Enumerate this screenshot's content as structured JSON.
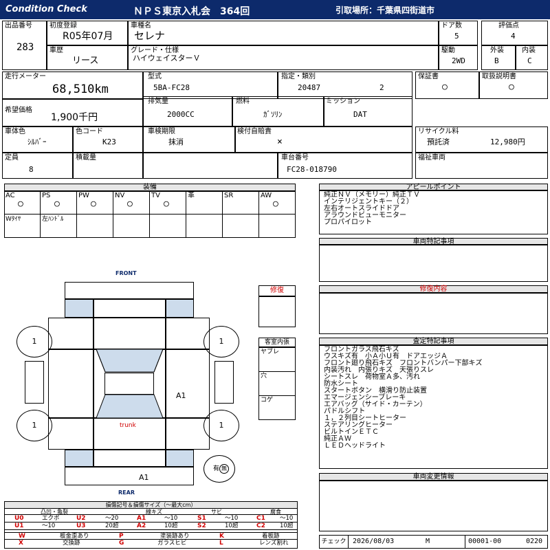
{
  "header": {
    "left": "Condition Check",
    "auction": "ＮＰＳ東京入札会　364回",
    "pickup": "引取場所：千葉県四街道市"
  },
  "row1": {
    "lot_label": "出品番号",
    "lot_value": "283",
    "first_reg_label": "初度登録",
    "first_reg_value": "R05年07月",
    "car_name_label": "車種名",
    "car_name_value": "セレナ",
    "doors_label": "ドア数",
    "doors_value": "5",
    "score_label": "評価点",
    "score_value": "4",
    "history_label": "車歴",
    "history_value": "リース",
    "grade_label": "グレード・仕様",
    "grade_value": "ハイウェイスターＶ",
    "drive_label": "駆動",
    "drive_value": "2WD",
    "ext_label": "外装",
    "ext_value": "B",
    "int_label": "内装",
    "int_value": "C"
  },
  "row2": {
    "odometer_label": "走行メーター",
    "odometer_value": "68,510km",
    "model_label": "型式",
    "model_value": "5BA-FC28",
    "designation_label": "指定・類別",
    "designation_value": "20487",
    "category_value": "2",
    "warranty_label": "保証書",
    "warranty_value": "○",
    "manual_label": "取扱説明書",
    "manual_value": "○",
    "price_label": "希望価格",
    "price_value": "1,900千円",
    "displacement_label": "排気量",
    "displacement_value": "2000CC",
    "fuel_label": "燃料",
    "fuel_value": "ｶﾞｿﾘﾝ",
    "mission_label": "ミッション",
    "mission_value": "DAT"
  },
  "row3": {
    "color_label": "車体色",
    "color_value": "ｼﾙﾊﾞｰ",
    "color_code_label": "色コード",
    "color_code_value": "K23",
    "inspection_label": "車検期限",
    "inspection_value": "抹消",
    "liability_label": "検付自賠責",
    "liability_value": "×",
    "recycle_label": "リサイクル料",
    "recycle_status": "預託済",
    "recycle_value": "12,980円",
    "capacity_label": "定員",
    "capacity_value": "8",
    "load_label": "積載量",
    "load_value": "",
    "chassis_label": "車台番号",
    "chassis_value": "FC28-018790",
    "welfare_label": "福祉車両",
    "welfare_value": ""
  },
  "equipment": {
    "title": "装備",
    "cols": [
      {
        "label": "AC",
        "value": "○"
      },
      {
        "label": "PS",
        "value": "○"
      },
      {
        "label": "PW",
        "value": "○"
      },
      {
        "label": "NV",
        "value": "○"
      },
      {
        "label": "TV",
        "value": "○"
      },
      {
        "label": "革",
        "value": ""
      },
      {
        "label": "SR",
        "value": ""
      },
      {
        "label": "AW",
        "value": "○"
      }
    ],
    "row2": [
      "Wﾀｲﾔ",
      "左ﾊﾝﾄﾞﾙ"
    ]
  },
  "diagram": {
    "front": "FRONT",
    "rear": "REAR",
    "trunk": "trunk",
    "tire_fl": "1",
    "tire_fr": "1",
    "tire_rl": "1",
    "tire_rr": "1",
    "mark_a1_side": "A1",
    "mark_a1_rear": "A1",
    "spare_label": "有",
    "spare_mark": "無"
  },
  "repair": {
    "title": "修復"
  },
  "cabin": {
    "title": "客室内張",
    "items": [
      "ヤブレ",
      "穴",
      "コゲ"
    ]
  },
  "appeal": {
    "title": "アピールポイント",
    "lines": [
      "純正ＮＶ（メモリー）純正ＴＶ",
      "インテリジェントキー（２）",
      "左右オートスライドドア",
      "アラウンドビューモニター",
      "プロパイロット"
    ]
  },
  "special": {
    "title": "車両特記事項"
  },
  "repair_content": {
    "title": "修復内容"
  },
  "inspection_notes": {
    "title": "査定特記事項",
    "lines": [
      "フロントガラス飛石キズ",
      "ウスキズ有　小Ａ小Ｕ有　ドアエッジＡ",
      "フロント廻り飛石キズ　フロントバンパー下部キズ",
      "内装汚れ　内張りキズ　天張りスレ",
      "シートスレ　荷物室Ａ多、汚れ",
      "防水シート",
      "スタートボタン　横滑り防止装置",
      "エマージェンシーブレーキ",
      "エアバッグ（サイド・カーテン）",
      "パドルシフト",
      "１，２列目シートヒーター",
      "ステアリングヒーター",
      "ビルトインＥＴＣ",
      "純正ＡＷ",
      "ＬＥＤヘッドライト"
    ]
  },
  "change_info": {
    "title": "車両変更情報"
  },
  "legend": {
    "title": "損傷記号＆損傷サイズ（～最大cm）",
    "groups": [
      "凸凹・亀裂",
      "線キズ",
      "サビ",
      "腐食"
    ],
    "rows": [
      [
        {
          "c": "U0",
          "t": "エクボ"
        },
        {
          "c": "U2",
          "t": "～20"
        },
        {
          "c": "A1",
          "t": "～10"
        },
        {
          "c": "S1",
          "t": "～10"
        },
        {
          "c": "C1",
          "t": "～10"
        }
      ],
      [
        {
          "c": "U1",
          "t": "～10"
        },
        {
          "c": "U3",
          "t": "20超"
        },
        {
          "c": "A2",
          "t": "10超"
        },
        {
          "c": "S2",
          "t": "10超"
        },
        {
          "c": "C2",
          "t": "10超"
        }
      ]
    ],
    "marks": [
      [
        {
          "c": "W",
          "t": "板金歪あり"
        },
        {
          "c": "P",
          "t": "塗装跡あり"
        },
        {
          "c": "K",
          "t": "着板跡"
        }
      ],
      [
        {
          "c": "X",
          "t": "交換跡"
        },
        {
          "c": "G",
          "t": "ガラスヒビ"
        },
        {
          "c": "L",
          "t": "レンズ割れ"
        }
      ]
    ]
  },
  "footer": {
    "check_label": "チェック",
    "date": "2026/08/03",
    "checker": "M",
    "code": "00001-00",
    "no": "0220"
  }
}
